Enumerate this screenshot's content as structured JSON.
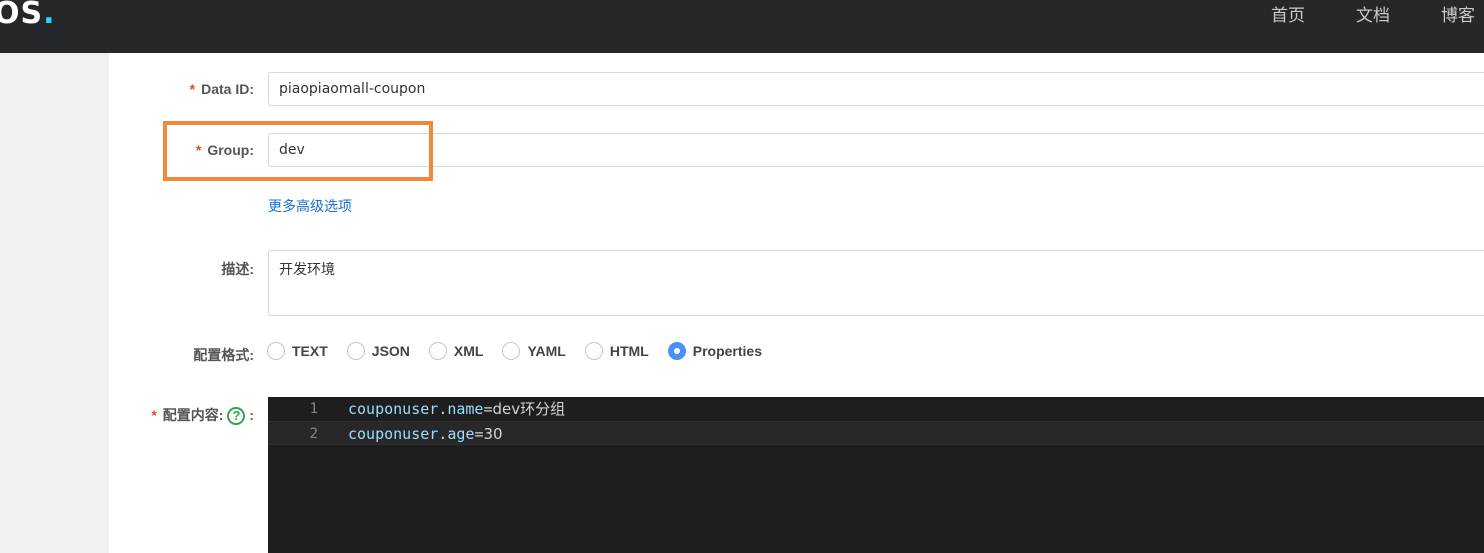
{
  "header": {
    "logo_text": "OS",
    "logo_dot": ".",
    "nav": [
      "首页",
      "文档",
      "博客"
    ]
  },
  "form": {
    "data_id": {
      "label": "Data ID:",
      "required_mark": "*",
      "value": "piaopiaomall-coupon"
    },
    "group": {
      "label": "Group:",
      "required_mark": "*",
      "value": "dev"
    },
    "advanced_link": "更多高级选项",
    "description": {
      "label": "描述:",
      "value": "开发环境"
    },
    "format": {
      "label": "配置格式:",
      "options": [
        "TEXT",
        "JSON",
        "XML",
        "YAML",
        "HTML",
        "Properties"
      ],
      "selected": "Properties"
    },
    "content": {
      "label": "配置内容:",
      "required_mark": "*",
      "help_glyph": "?",
      "suffix": ":",
      "lines": [
        {
          "num": "1",
          "key_prefix": "couponuser",
          "dot": ".",
          "key": "name",
          "op": "=",
          "value": "dev环分组"
        },
        {
          "num": "2",
          "key_prefix": "couponuser",
          "dot": ".",
          "key": "age",
          "op": "=",
          "value": "30"
        }
      ]
    }
  },
  "colors": {
    "topbar": "#25282b",
    "sidebar": "#eef0f4",
    "highlight": "#f0883a",
    "accent": "#4c8ff7",
    "link": "#1b6fd0",
    "editor_bg": "#1e1e1e"
  }
}
